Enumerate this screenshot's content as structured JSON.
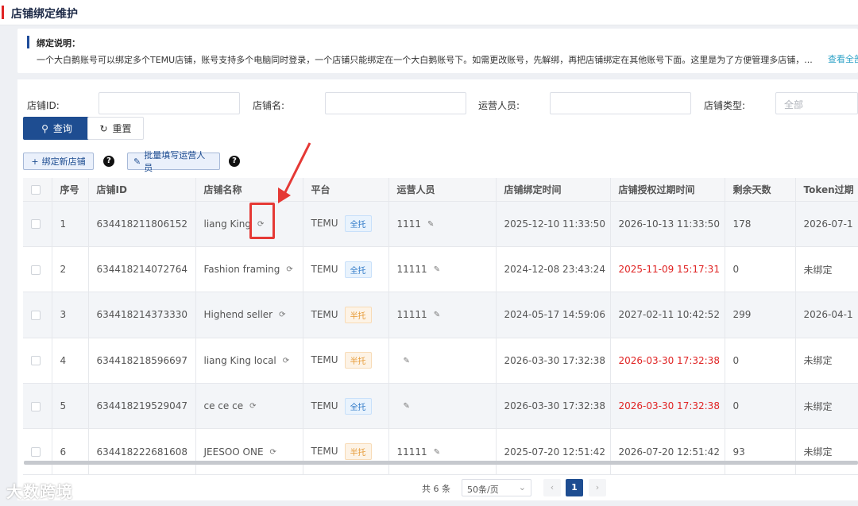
{
  "header": {
    "title": "店铺绑定维护"
  },
  "notice": {
    "title": "绑定说明：",
    "text": "一个大白鹅账号可以绑定多个TEMU店铺，账号支持多个电脑同时登录，一个店铺只能绑定在一个大白鹅账号下。如需更改账号，先解绑，再把店铺绑定在其他账号下面。这里是为了方便管理多店铺，...",
    "view_all": "查看全部"
  },
  "filters": {
    "shop_id_label": "店铺ID:",
    "shop_name_label": "店铺名:",
    "operator_label": "运营人员:",
    "shop_type_label": "店铺类型:",
    "shop_type_value": "全部"
  },
  "buttons": {
    "query": "查询",
    "reset": "重置",
    "bind_new": "绑定新店铺",
    "batch_fill": "批量填写运营人员"
  },
  "table": {
    "headers": [
      "序号",
      "店铺ID",
      "店铺名称",
      "平台",
      "运营人员",
      "店铺绑定时间",
      "店铺授权过期时间",
      "剩余天数",
      "Token过期"
    ],
    "rows": [
      {
        "no": "1",
        "shop_id": "634418211806152",
        "name": "liang King",
        "platform": "TEMU",
        "tag": "全托",
        "tag_type": "full",
        "operator": "1111",
        "bind_time": "2025-12-10 11:33:50",
        "expire": "2026-10-13 11:33:50",
        "expire_red": false,
        "days": "178",
        "token": "2026-07-1"
      },
      {
        "no": "2",
        "shop_id": "634418214072764",
        "name": "Fashion framing",
        "platform": "TEMU",
        "tag": "全托",
        "tag_type": "full",
        "operator": "11111",
        "bind_time": "2024-12-08 23:43:24",
        "expire": "2025-11-09 15:17:31",
        "expire_red": true,
        "days": "0",
        "token": "未绑定"
      },
      {
        "no": "3",
        "shop_id": "634418214373330",
        "name": "Highend seller",
        "platform": "TEMU",
        "tag": "半托",
        "tag_type": "half",
        "operator": "11111",
        "bind_time": "2024-05-17 14:59:06",
        "expire": "2027-02-11 10:42:52",
        "expire_red": false,
        "days": "299",
        "token": "2026-04-1"
      },
      {
        "no": "4",
        "shop_id": "634418218596697",
        "name": "liang King local",
        "platform": "TEMU",
        "tag": "半托",
        "tag_type": "half",
        "operator": "",
        "bind_time": "2026-03-30 17:32:38",
        "expire": "2026-03-30 17:32:38",
        "expire_red": true,
        "days": "0",
        "token": "未绑定"
      },
      {
        "no": "5",
        "shop_id": "634418219529047",
        "name": "ce ce ce",
        "platform": "TEMU",
        "tag": "全托",
        "tag_type": "full",
        "operator": "",
        "bind_time": "2026-03-30 17:32:38",
        "expire": "2026-03-30 17:32:38",
        "expire_red": true,
        "days": "0",
        "token": "未绑定"
      },
      {
        "no": "6",
        "shop_id": "634418222681608",
        "name": "JEESOO ONE",
        "platform": "TEMU",
        "tag": "半托",
        "tag_type": "half",
        "operator": "11111",
        "bind_time": "2025-07-20 12:51:42",
        "expire": "2026-07-20 12:51:42",
        "expire_red": false,
        "days": "93",
        "token": "未绑定"
      }
    ]
  },
  "pagination": {
    "total": "共 6 条",
    "page_size": "50条/页",
    "current": "1"
  },
  "watermark": "大数跨境",
  "colors": {
    "primary": "#1e4d91",
    "danger": "#e02424",
    "highlight": "#e53935"
  }
}
